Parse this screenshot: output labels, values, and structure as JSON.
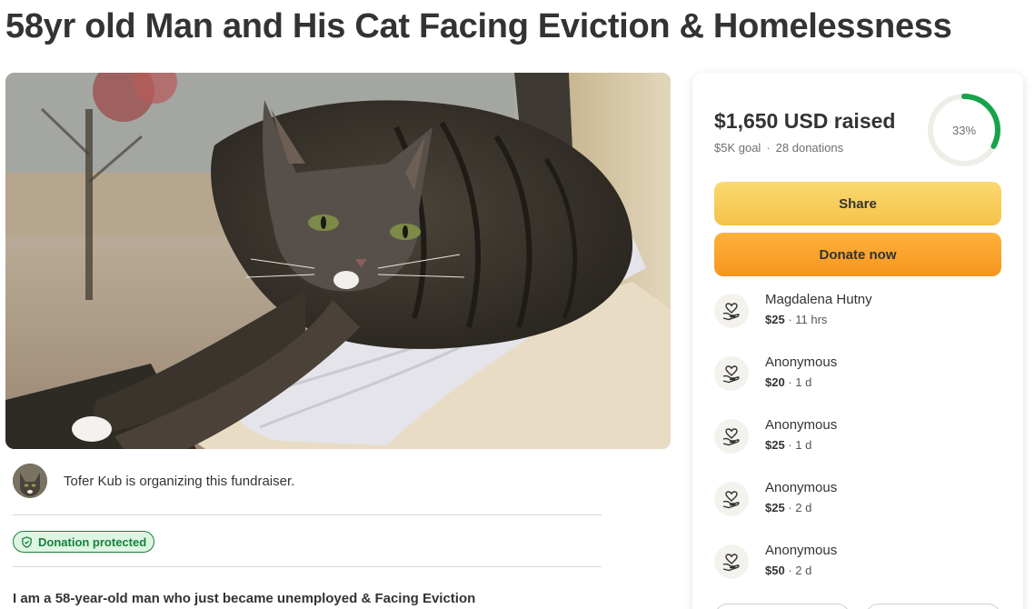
{
  "page": {
    "title": "58yr old Man and His Cat Facing Eviction & Homelessness"
  },
  "organizer": {
    "text": "Tofer Kub is organizing this fundraiser."
  },
  "badge": {
    "label": "Donation protected"
  },
  "story": {
    "first_line": "I am a 58-year-old man who just became unemployed & Facing Eviction"
  },
  "progress": {
    "raised": "$1,650 USD raised",
    "goal": "$5K goal",
    "separator": "·",
    "donations": "28 donations",
    "percent_label": "33%",
    "percent": 33,
    "ring_color": "#16a34a"
  },
  "buttons": {
    "share": "Share",
    "donate": "Donate now"
  },
  "donors": [
    {
      "name": "Magdalena Hutny",
      "amount": "$25",
      "time": " · 11 hrs"
    },
    {
      "name": "Anonymous",
      "amount": "$20",
      "time": " · 1 d"
    },
    {
      "name": "Anonymous",
      "amount": "$25",
      "time": " · 1 d"
    },
    {
      "name": "Anonymous",
      "amount": "$25",
      "time": " · 2 d"
    },
    {
      "name": "Anonymous",
      "amount": "$50",
      "time": " · 2 d"
    }
  ],
  "icons": {
    "donor": "heart-hand-icon",
    "badge": "shield-icon"
  }
}
